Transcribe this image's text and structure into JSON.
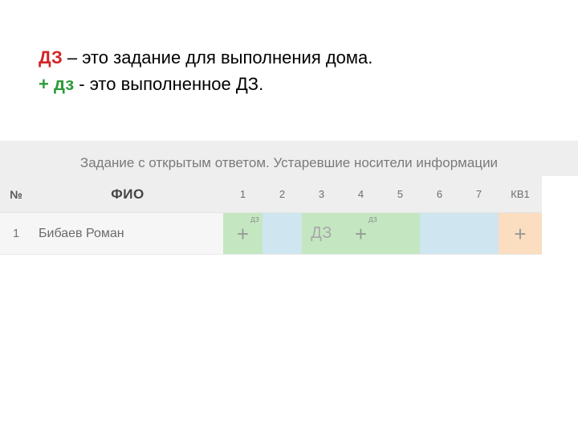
{
  "legend": {
    "dz_label": "ДЗ",
    "dz_rest": " – это задание для выполнения дома.",
    "plus_label": "+ дз",
    "plus_rest": " - это выполненное ДЗ."
  },
  "table": {
    "title": "Задание с открытым ответом. Устаревшие носители информации",
    "headers": {
      "num": "№",
      "fio": "ФИО",
      "cols": [
        "1",
        "2",
        "3",
        "4",
        "5",
        "6",
        "7"
      ],
      "last": "КВ1"
    },
    "row": {
      "num": "1",
      "name": "Бибаев Роман",
      "cells": [
        {
          "mark": "+",
          "badge": "ДЗ",
          "color": "green"
        },
        {
          "mark": "",
          "badge": "",
          "color": "blue"
        },
        {
          "mark": "ДЗ",
          "badge": "",
          "color": "green"
        },
        {
          "mark": "+",
          "badge": "ДЗ",
          "color": "green"
        },
        {
          "mark": "",
          "badge": "",
          "color": "green"
        },
        {
          "mark": "",
          "badge": "",
          "color": "blue"
        },
        {
          "mark": "",
          "badge": "",
          "color": "blue"
        }
      ],
      "last": {
        "mark": "+",
        "color": "peach"
      }
    }
  }
}
